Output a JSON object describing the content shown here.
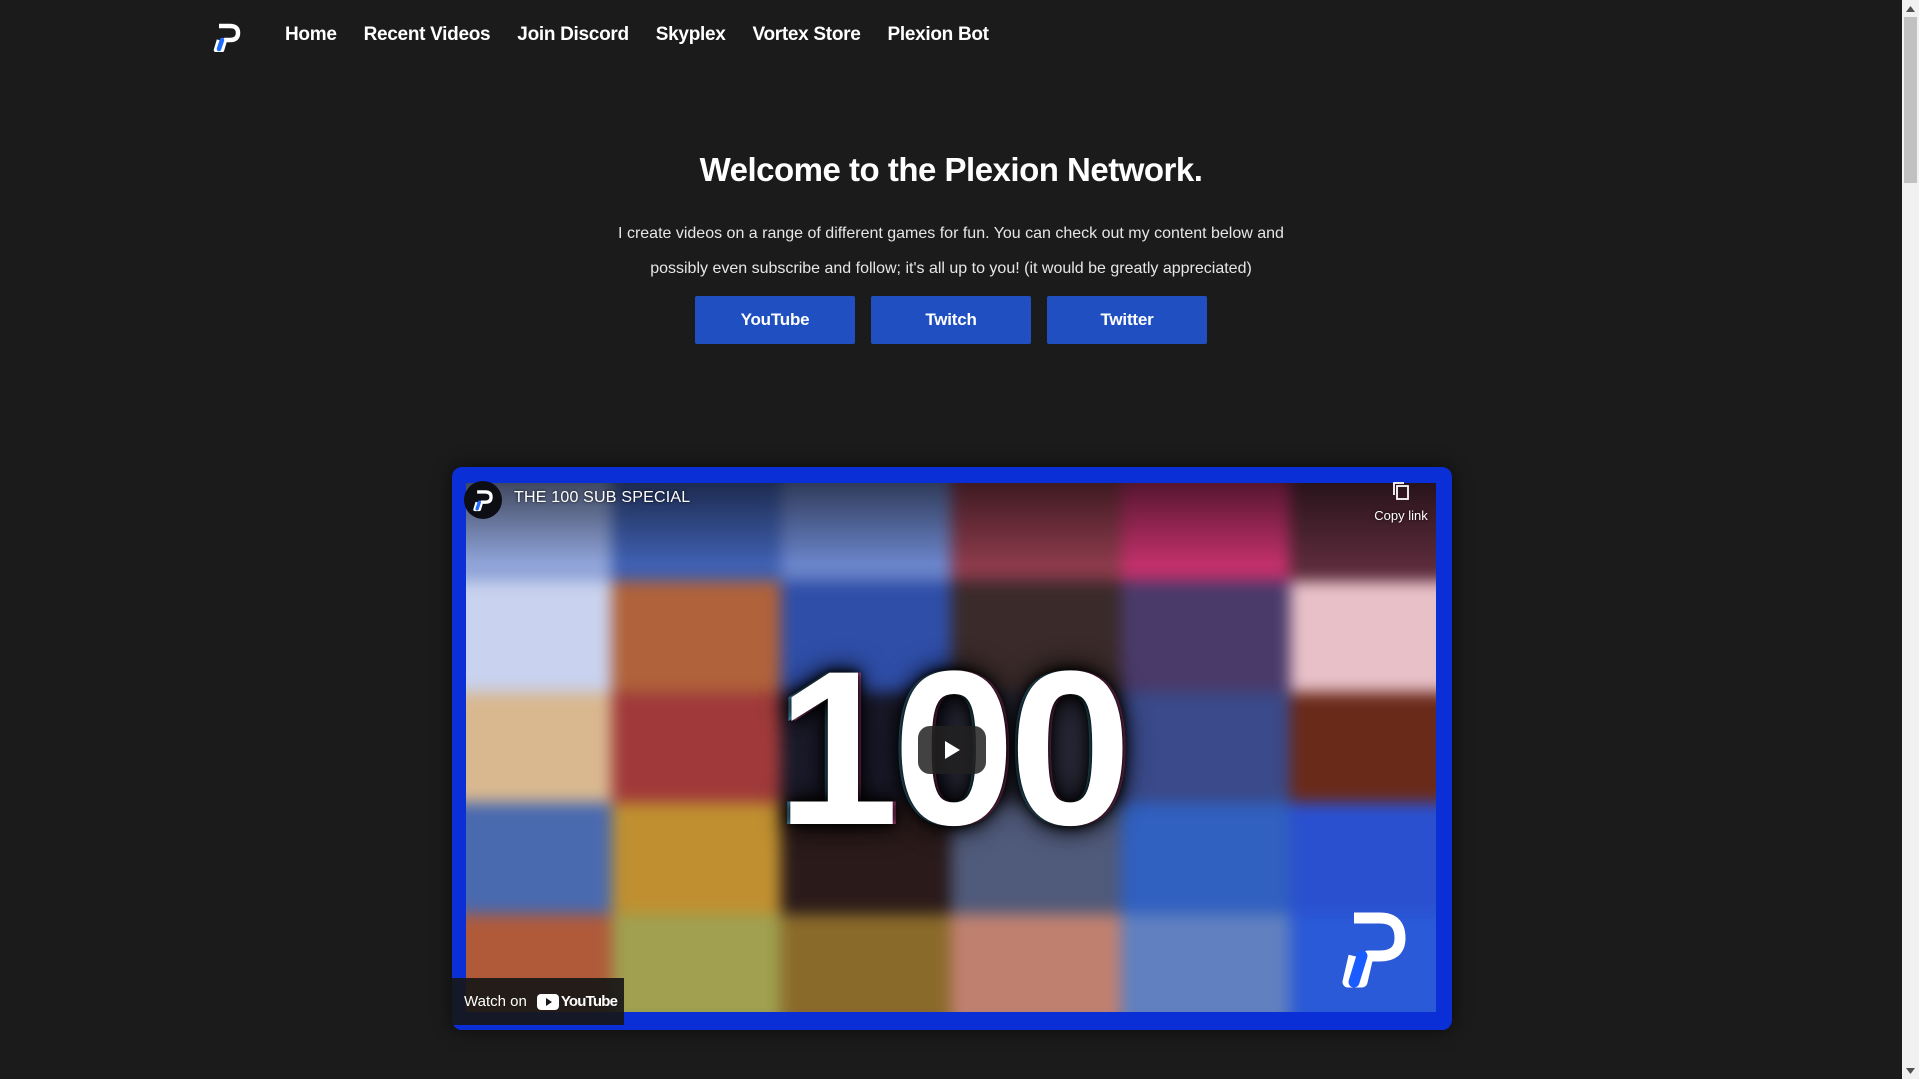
{
  "nav": {
    "items": [
      {
        "label": "Home"
      },
      {
        "label": "Recent Videos"
      },
      {
        "label": "Join Discord"
      },
      {
        "label": "Skyplex"
      },
      {
        "label": "Vortex Store"
      },
      {
        "label": "Plexion Bot"
      }
    ],
    "logo_icon": "plexion-p-logo"
  },
  "hero": {
    "title": "Welcome to the Plexion Network.",
    "text": "I create videos on a range of different games for fun. You can check out my content below and possibly even subscribe and follow; it's all up to you! (it would be greatly appreciated)",
    "buttons": [
      {
        "label": "YouTube"
      },
      {
        "label": "Twitch"
      },
      {
        "label": "Twitter"
      }
    ],
    "button_color": "#1f4fc0"
  },
  "video": {
    "title": "THE 100 SUB SPECIAL",
    "thumbnail_text": "100",
    "copy_link_label": "Copy link",
    "watch_on_label": "Watch on",
    "youtube_wordmark": "YouTube",
    "frame_color": "#0a2fd6"
  },
  "colors": {
    "background": "#1b1b1b",
    "accent": "#1f4fc0"
  }
}
